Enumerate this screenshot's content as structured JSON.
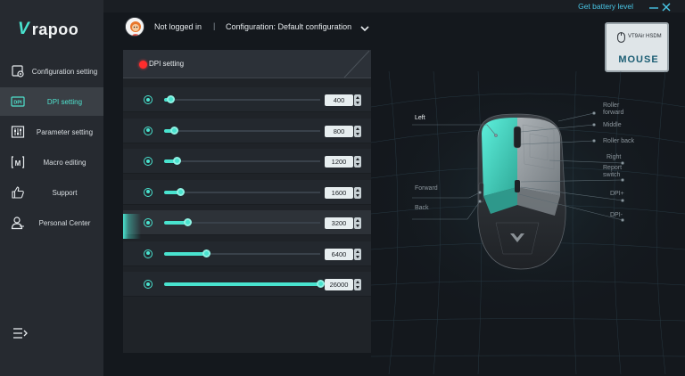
{
  "app": {
    "brand_mark": "V",
    "brand_name": "rapoo"
  },
  "topbar": {
    "battery_link": "Get battery level"
  },
  "header": {
    "login_status": "Not logged in",
    "separator": "|",
    "configuration": "Configuration: Default configuration"
  },
  "sidebar": {
    "items": [
      {
        "label": "Configuration setting",
        "icon": "config-icon"
      },
      {
        "label": "DPI setting",
        "icon": "dpi-icon",
        "active": true
      },
      {
        "label": "Parameter setting",
        "icon": "sliders-icon"
      },
      {
        "label": "Macro editing",
        "icon": "macro-icon"
      },
      {
        "label": "Support",
        "icon": "thumbs-up-icon"
      },
      {
        "label": "Personal Center",
        "icon": "user-icon"
      }
    ]
  },
  "dpi": {
    "title": "DPI setting",
    "max": 26000,
    "levels": [
      {
        "value": "400",
        "fraction": 0.04
      },
      {
        "value": "800",
        "fraction": 0.06
      },
      {
        "value": "1200",
        "fraction": 0.08
      },
      {
        "value": "1600",
        "fraction": 0.1
      },
      {
        "value": "3200",
        "fraction": 0.15
      },
      {
        "value": "6400",
        "fraction": 0.27
      },
      {
        "value": "26000",
        "fraction": 1.0
      }
    ],
    "active_index": 4
  },
  "device": {
    "model": "VT9Air HSDM",
    "type": "MOUSE"
  },
  "mouse_buttons": {
    "left": "Left",
    "forward": "Forward",
    "back": "Back",
    "roller_forward_1": "Roller",
    "roller_forward_2": "forward",
    "middle": "Middle",
    "roller_back": "Roller back",
    "right": "Right",
    "report_switch_1": "Report",
    "report_switch_2": "switch",
    "dpi_plus": "DPI+",
    "dpi_minus": "DPI-"
  },
  "colors": {
    "accent": "#49e3cf",
    "link": "#49c6e6",
    "dot": "#ff2d2d"
  }
}
